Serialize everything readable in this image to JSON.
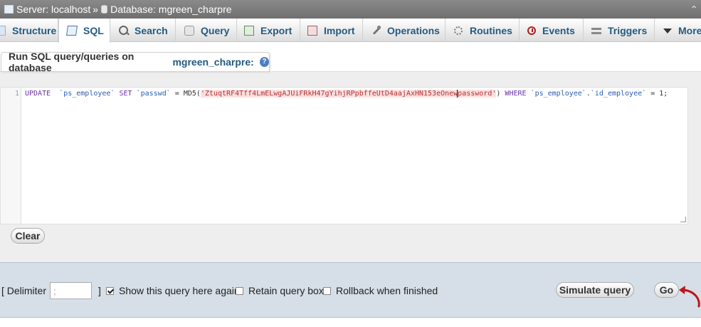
{
  "breadcrumb": {
    "server_label": "Server: localhost",
    "separator": "»",
    "database_label": "Database: mgreen_charpre",
    "collapse_icon": "collapse-icon"
  },
  "tabs": [
    {
      "label": "Structure",
      "icon": "structure-icon"
    },
    {
      "label": "SQL",
      "icon": "sql-icon",
      "active": true
    },
    {
      "label": "Search",
      "icon": "search-icon"
    },
    {
      "label": "Query",
      "icon": "query-icon"
    },
    {
      "label": "Export",
      "icon": "export-icon"
    },
    {
      "label": "Import",
      "icon": "import-icon"
    },
    {
      "label": "Operations",
      "icon": "operations-icon"
    },
    {
      "label": "Routines",
      "icon": "routines-icon"
    },
    {
      "label": "Events",
      "icon": "events-icon"
    },
    {
      "label": "Triggers",
      "icon": "triggers-icon"
    },
    {
      "label": "More",
      "icon": "chevron-down-icon"
    }
  ],
  "sql_panel": {
    "heading": "Run SQL query/queries on database",
    "database": "mgreen_charpre:",
    "help_icon": "?"
  },
  "editor": {
    "line_number": "1",
    "tokens": {
      "kw_update": "UPDATE",
      "t_table": "`ps_employee`",
      "kw_set": "SET",
      "t_col": "`passwd`",
      "eq": "=",
      "fn_md5": "MD5(",
      "str_a": "'ZtuqtRF4Tff4LmELwgAJUiFRkH47gYihjRPpbffeUtD4aajAxHN153eOnew",
      "str_b": "password'",
      "close": ")",
      "kw_where": "WHERE",
      "t_table2": "`ps_employee`",
      "dot": ".",
      "t_col2": "`id_employee`",
      "eq2": "=",
      "num": "1;"
    }
  },
  "buttons": {
    "clear": "Clear",
    "simulate": "Simulate query",
    "go": "Go"
  },
  "options": {
    "delimiter_label": "[ Delimiter",
    "delimiter_value": ";",
    "bracket_close": "]",
    "show_query": {
      "label": "Show this query here again",
      "checked": true
    },
    "retain_box": {
      "label": "Retain query box",
      "checked": false
    },
    "rollback": {
      "label": "Rollback when finished",
      "checked": false
    }
  },
  "colors": {
    "accent_link": "#235a81",
    "arrow": "#c0141c"
  }
}
